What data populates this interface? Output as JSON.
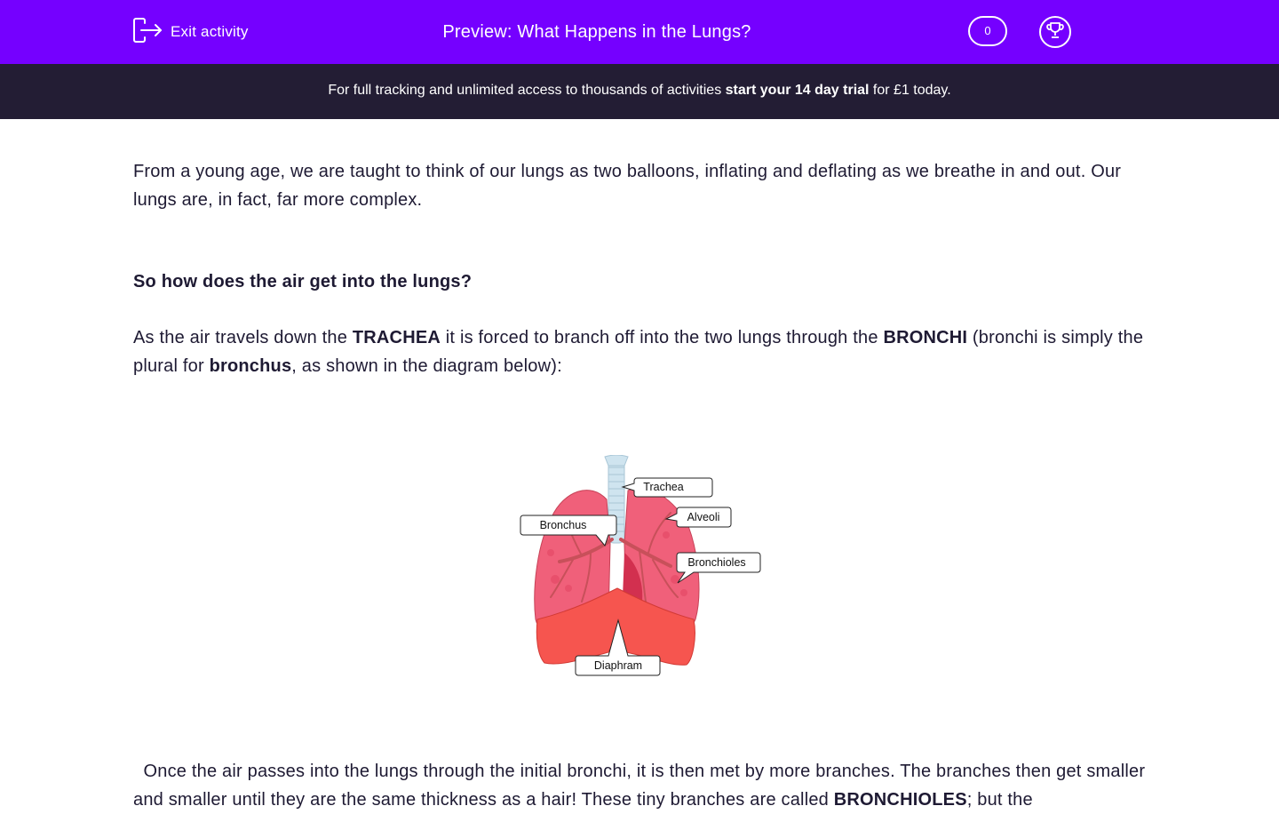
{
  "header": {
    "exit_label": "Exit activity",
    "title": "Preview: What Happens in the Lungs?",
    "score": "0"
  },
  "banner": {
    "text_before": "For full tracking and unlimited access to thousands of activities ",
    "text_bold": "start your 14 day trial",
    "text_after": " for £1 today."
  },
  "content": {
    "intro": "From a young age, we are taught to think of our lungs as two balloons, inflating and deflating as we breathe in and out. Our lungs are, in fact, far more complex.",
    "heading": "So how does the air get into the lungs?",
    "para2": {
      "t1": "As the air travels down the ",
      "b1": "TRACHEA",
      "t2": " it is forced to branch off into the two lungs through the ",
      "b2": "BRONCHI",
      "t3": " (bronchi is simply the plural for ",
      "b3": "bronchus",
      "t4": ", as shown in the diagram below):"
    },
    "para3": {
      "t1": "  Once the air passes into the lungs through the initial bronchi, it is then met by more branches. The branches then get smaller and smaller until they are the same thickness as a hair! These tiny branches are called ",
      "b1": "BRONCHIOLES",
      "t2": "; but the"
    }
  },
  "diagram": {
    "labels": {
      "trachea": "Trachea",
      "alveoli": "Alveoli",
      "bronchus": "Bronchus",
      "bronchioles": "Bronchioles",
      "diaphragm": "Diaphram"
    }
  },
  "colors": {
    "header": "#7500ff",
    "banner": "#231d34",
    "lung": "#f0607a",
    "diaphragm": "#f6554f"
  },
  "icons": {
    "exit": "exit-icon",
    "trophy": "trophy-icon"
  }
}
